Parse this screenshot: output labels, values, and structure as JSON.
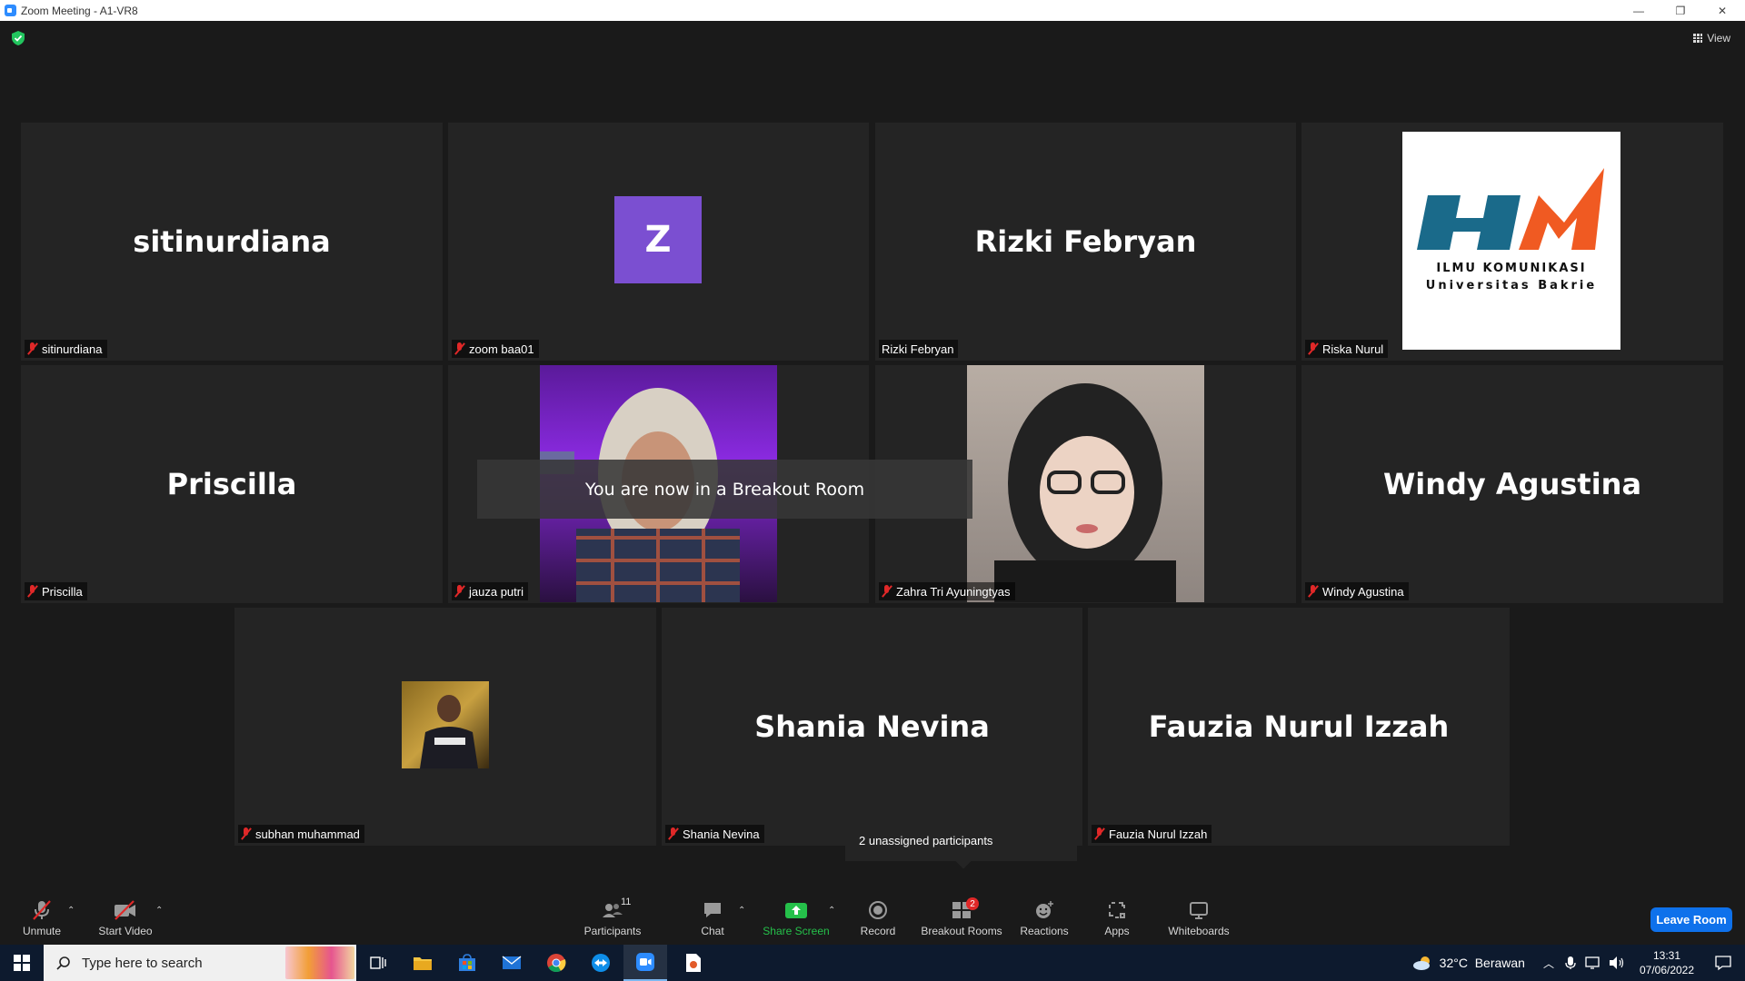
{
  "window": {
    "title": "Zoom Meeting - A1-VR8",
    "minimize": "—",
    "restore": "❐",
    "close": "✕"
  },
  "header": {
    "view_label": "View"
  },
  "tiles": [
    {
      "big_name": "sitinurdiana",
      "label": "sitinurdiana",
      "muted": true
    },
    {
      "avatar_letter": "Z",
      "label": "zoom baa01",
      "muted": true
    },
    {
      "big_name": "Rizki Febryan",
      "label": "Rizki Febryan",
      "muted": false
    },
    {
      "logo_line1": "ILMU KOMUNIKASI",
      "logo_line2": "Universitas Bakrie",
      "label": "Riska Nurul",
      "muted": true
    },
    {
      "big_name": "Priscilla",
      "label": "Priscilla",
      "muted": true
    },
    {
      "label": "jauza putri",
      "muted": true
    },
    {
      "label": "Zahra Tri Ayuningtyas",
      "muted": true
    },
    {
      "big_name": "Windy Agustina",
      "label": "Windy Agustina",
      "muted": true
    },
    {
      "label": "subhan muhammad",
      "muted": true
    },
    {
      "big_name": "Shania Nevina",
      "label": "Shania Nevina",
      "muted": true
    },
    {
      "big_name": "Fauzia Nurul Izzah",
      "label": "Fauzia Nurul Izzah",
      "muted": true
    }
  ],
  "toast": "You are now in a Breakout Room",
  "tooltip": "2 unassigned participants",
  "toolbar": {
    "unmute": "Unmute",
    "start_video": "Start Video",
    "participants": "Participants",
    "participants_count": "11",
    "chat": "Chat",
    "share_screen": "Share Screen",
    "record": "Record",
    "breakout_rooms": "Breakout Rooms",
    "breakout_badge": "2",
    "reactions": "Reactions",
    "apps": "Apps",
    "whiteboards": "Whiteboards",
    "leave": "Leave Room"
  },
  "taskbar": {
    "search_placeholder": "Type here to search",
    "weather": "32°C  Berawan",
    "time": "13:31",
    "date": "07/06/2022"
  },
  "colors": {
    "accent": "#0e71eb",
    "share_green": "#25c04a",
    "muted_red": "#e02828",
    "tile_bg": "#242424",
    "avatar_purple": "#7b4fd1"
  }
}
